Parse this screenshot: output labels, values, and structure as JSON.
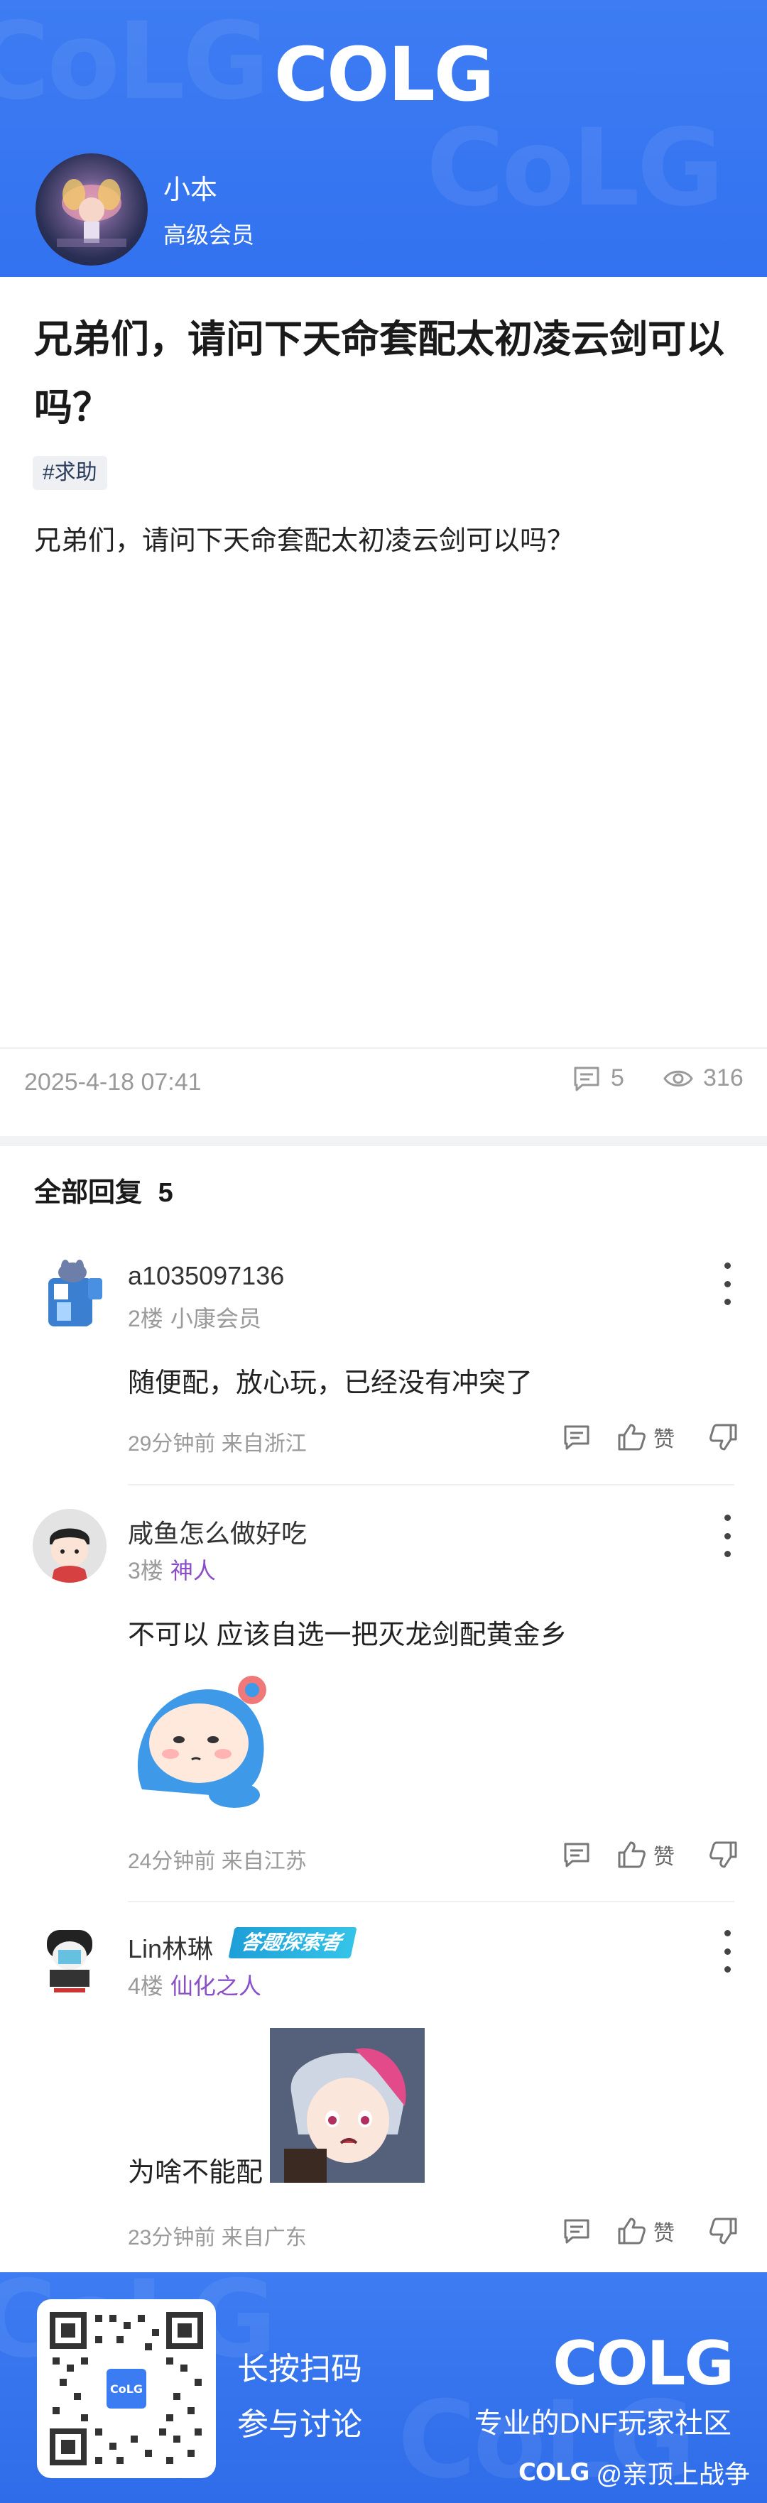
{
  "header": {
    "logo": "COLG",
    "author_name": "小本",
    "author_level": "高级会员"
  },
  "post": {
    "title": "兄弟们，请问下天命套配太初凌云剑可以吗？",
    "tag": "#求助",
    "body": "兄弟们，请问下天命套配太初凌云剑可以吗？",
    "date": "2025-4-18 07:41",
    "comment_count": "5",
    "view_count": "316"
  },
  "replies_section": {
    "title": "全部回复",
    "count": "5"
  },
  "replies": [
    {
      "nick": "a1035097136",
      "floor": "2楼",
      "rank": "小康会员",
      "content": "随便配，放心玩，已经没有冲突了",
      "time": "29分钟前 来自浙江",
      "like_label": "赞"
    },
    {
      "nick": "咸鱼怎么做好吃",
      "floor": "3楼",
      "rank": "神人",
      "content": "不可以  应该自选一把灭龙剑配黄金乡",
      "time": "24分钟前 来自江苏",
      "like_label": "赞"
    },
    {
      "nick": "Lin林琳",
      "badge": "答题探索者",
      "floor": "4楼",
      "rank": "仙化之人",
      "content": "为啥不能配",
      "time": "23分钟前 来自广东",
      "like_label": "赞"
    }
  ],
  "footer": {
    "qr_line1": "长按扫码",
    "qr_line2": "参与讨论",
    "logo": "COLG",
    "slogan": "专业的DNF玩家社区",
    "credit_logo": "COLG",
    "credit": "@亲顶上战争"
  },
  "colors": {
    "brand_blue": "#3372f0",
    "rank_purple": "#8a4fc8",
    "muted_text": "#9a9a9a"
  }
}
